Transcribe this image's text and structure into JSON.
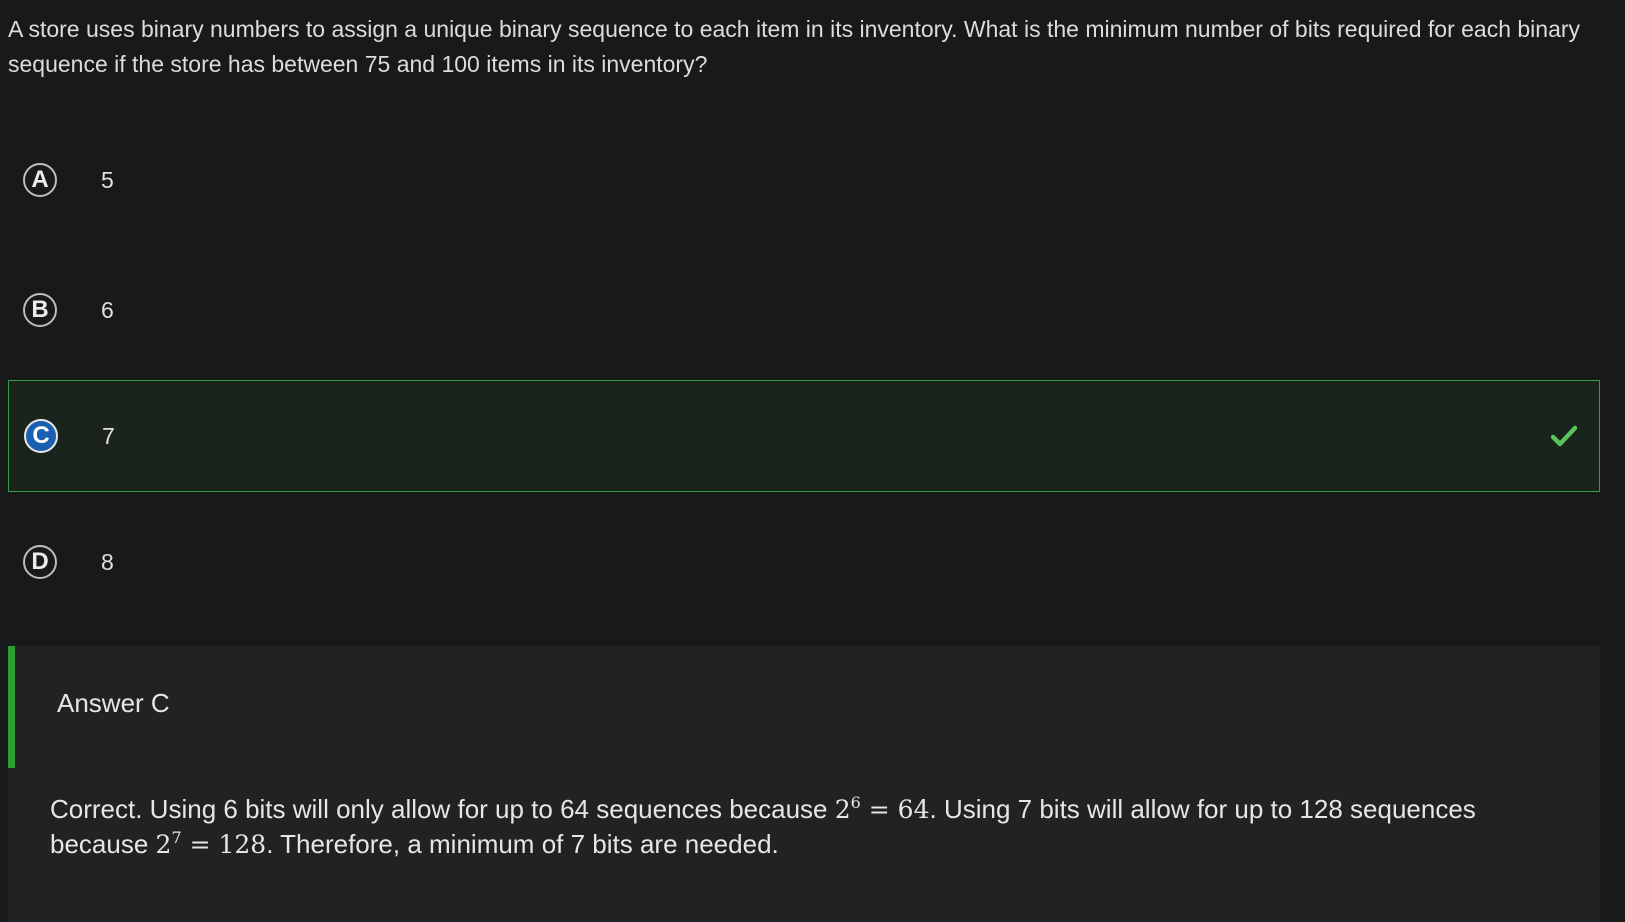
{
  "question": {
    "text": "A store uses binary numbers to assign a unique binary sequence to each item in its inventory. What is the minimum number of bits required for each binary sequence if the store has between 75 and 100 items in its inventory?"
  },
  "choices": [
    {
      "letter": "A",
      "text": "5",
      "correct": false
    },
    {
      "letter": "B",
      "text": "6",
      "correct": false
    },
    {
      "letter": "C",
      "text": "7",
      "correct": true
    },
    {
      "letter": "D",
      "text": "8",
      "correct": false
    }
  ],
  "explanation": {
    "title": "Answer C",
    "part1": "Correct. Using 6 bits will only allow for up to 64 sequences because ",
    "math1_base": "2",
    "math1_exp": "6",
    "math1_rest": " = 64",
    "part2": ". Using 7 bits will allow for up to 128 sequences because ",
    "math2_base": "2",
    "math2_exp": "7",
    "math2_rest": " = 128",
    "part3": ". Therefore, a minimum of 7 bits are needed."
  },
  "colors": {
    "background": "#18191b",
    "correct_border": "#3f9a3f",
    "correct_fill": "#1b231d",
    "selected_letter": "#1a5fb0",
    "accent_bar": "#2e9e30",
    "check": "#5cc35c"
  },
  "icons": {
    "correct_indicator": "checkmark-icon"
  }
}
